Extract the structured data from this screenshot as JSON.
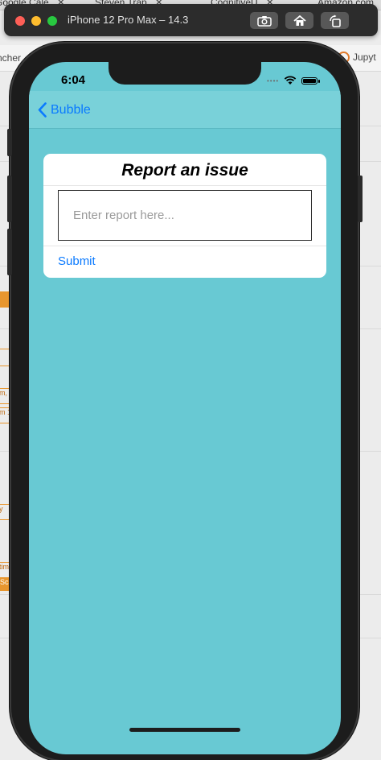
{
  "background": {
    "tabs": [
      {
        "label": "Google Cale",
        "close": "✕"
      },
      {
        "label": "Steven Trap",
        "close": "✕"
      },
      {
        "label": "CognitiveU",
        "close": "✕"
      },
      {
        "label": "Amazon.com",
        "close": ""
      }
    ],
    "toolbar_left": "ncher",
    "toolbar_right": "Jupyt",
    "orange_snippets": [
      "m,",
      "m 1",
      "y",
      "tim",
      "Sca"
    ]
  },
  "simulator": {
    "title": "iPhone 12 Pro Max – 14.3",
    "buttons": [
      "screenshot-icon",
      "home-icon",
      "rotate-icon"
    ]
  },
  "status_bar": {
    "time": "6:04",
    "signal": "••••"
  },
  "nav": {
    "back_label": "Bubble"
  },
  "card": {
    "title": "Report an issue",
    "input_placeholder": "Enter report here...",
    "input_value": "",
    "submit_label": "Submit"
  },
  "colors": {
    "screen_bg": "#68c9d3",
    "navbar_bg": "#79d1d9",
    "accent": "#0a7aff",
    "card_bg": "#ffffff"
  }
}
